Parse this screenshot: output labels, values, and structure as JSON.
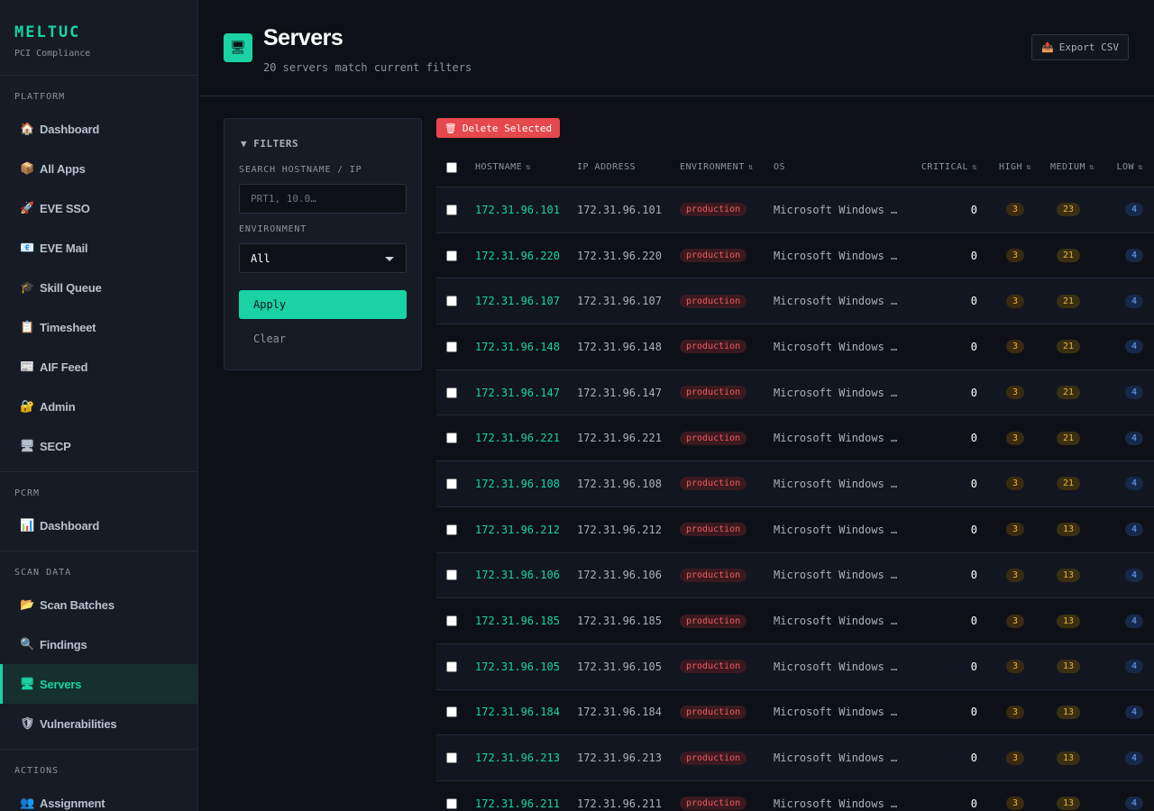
{
  "brand": {
    "name": "MELTUC",
    "subtitle": "PCI Compliance"
  },
  "sidebar": {
    "sections": [
      {
        "heading": "PLATFORM",
        "items": [
          {
            "icon": "🏠",
            "label": "Dashboard"
          },
          {
            "icon": "📦",
            "label": "All Apps"
          },
          {
            "icon": "🚀",
            "label": "EVE SSO"
          },
          {
            "icon": "📧",
            "label": "EVE Mail"
          },
          {
            "icon": "🎓",
            "label": "Skill Queue"
          },
          {
            "icon": "📋",
            "label": "Timesheet"
          },
          {
            "icon": "📰",
            "label": "AIF Feed"
          },
          {
            "icon": "🔐",
            "label": "Admin"
          },
          {
            "icon": "🖥",
            "label": "SECP"
          }
        ]
      },
      {
        "heading": "PCRM",
        "items": [
          {
            "icon": "📊",
            "label": "Dashboard"
          }
        ]
      },
      {
        "heading": "SCAN DATA",
        "items": [
          {
            "icon": "📂",
            "label": "Scan Batches"
          },
          {
            "icon": "🔍",
            "label": "Findings"
          },
          {
            "icon": "🖥",
            "label": "Servers",
            "active": true
          },
          {
            "icon": "🛡",
            "label": "Vulnerabilities"
          }
        ]
      },
      {
        "heading": "ACTIONS",
        "items": [
          {
            "icon": "👥",
            "label": "Assignment"
          }
        ]
      }
    ]
  },
  "header": {
    "icon": "🖥",
    "title": "Servers",
    "subtitle": "20 servers match current filters",
    "export_icon": "📤",
    "export_label": "Export CSV"
  },
  "filters": {
    "title": "▼ FILTERS",
    "search_label": "SEARCH HOSTNAME / IP",
    "search_placeholder": "PRT1, 10.0…",
    "search_value": "",
    "env_label": "ENVIRONMENT",
    "env_value": "All",
    "apply_label": "Apply",
    "clear_label": "Clear"
  },
  "actions": {
    "delete_icon": "🗑",
    "delete_label": "Delete Selected"
  },
  "table": {
    "columns": {
      "hostname": "HOSTNAME",
      "ip": "IP ADDRESS",
      "environment": "ENVIRONMENT",
      "os": "OS",
      "critical": "CRITICAL",
      "high": "HIGH",
      "medium": "MEDIUM",
      "low": "LOW"
    },
    "sort_glyph": "⇅",
    "rows": [
      {
        "hostname": "172.31.96.101",
        "ip": "172.31.96.101",
        "env": "production",
        "os": "Microsoft Windows …",
        "critical": "0",
        "high": "3",
        "medium": "23",
        "low": "4"
      },
      {
        "hostname": "172.31.96.220",
        "ip": "172.31.96.220",
        "env": "production",
        "os": "Microsoft Windows …",
        "critical": "0",
        "high": "3",
        "medium": "21",
        "low": "4"
      },
      {
        "hostname": "172.31.96.107",
        "ip": "172.31.96.107",
        "env": "production",
        "os": "Microsoft Windows …",
        "critical": "0",
        "high": "3",
        "medium": "21",
        "low": "4"
      },
      {
        "hostname": "172.31.96.148",
        "ip": "172.31.96.148",
        "env": "production",
        "os": "Microsoft Windows …",
        "critical": "0",
        "high": "3",
        "medium": "21",
        "low": "4"
      },
      {
        "hostname": "172.31.96.147",
        "ip": "172.31.96.147",
        "env": "production",
        "os": "Microsoft Windows …",
        "critical": "0",
        "high": "3",
        "medium": "21",
        "low": "4"
      },
      {
        "hostname": "172.31.96.221",
        "ip": "172.31.96.221",
        "env": "production",
        "os": "Microsoft Windows …",
        "critical": "0",
        "high": "3",
        "medium": "21",
        "low": "4"
      },
      {
        "hostname": "172.31.96.108",
        "ip": "172.31.96.108",
        "env": "production",
        "os": "Microsoft Windows …",
        "critical": "0",
        "high": "3",
        "medium": "21",
        "low": "4"
      },
      {
        "hostname": "172.31.96.212",
        "ip": "172.31.96.212",
        "env": "production",
        "os": "Microsoft Windows …",
        "critical": "0",
        "high": "3",
        "medium": "13",
        "low": "4"
      },
      {
        "hostname": "172.31.96.106",
        "ip": "172.31.96.106",
        "env": "production",
        "os": "Microsoft Windows …",
        "critical": "0",
        "high": "3",
        "medium": "13",
        "low": "4"
      },
      {
        "hostname": "172.31.96.185",
        "ip": "172.31.96.185",
        "env": "production",
        "os": "Microsoft Windows …",
        "critical": "0",
        "high": "3",
        "medium": "13",
        "low": "4"
      },
      {
        "hostname": "172.31.96.105",
        "ip": "172.31.96.105",
        "env": "production",
        "os": "Microsoft Windows …",
        "critical": "0",
        "high": "3",
        "medium": "13",
        "low": "4"
      },
      {
        "hostname": "172.31.96.184",
        "ip": "172.31.96.184",
        "env": "production",
        "os": "Microsoft Windows …",
        "critical": "0",
        "high": "3",
        "medium": "13",
        "low": "4"
      },
      {
        "hostname": "172.31.96.213",
        "ip": "172.31.96.213",
        "env": "production",
        "os": "Microsoft Windows …",
        "critical": "0",
        "high": "3",
        "medium": "13",
        "low": "4"
      },
      {
        "hostname": "172.31.96.211",
        "ip": "172.31.96.211",
        "env": "production",
        "os": "Microsoft Windows …",
        "critical": "0",
        "high": "3",
        "medium": "13",
        "low": "4"
      }
    ]
  },
  "colors": {
    "accent": "#19d3a5",
    "danger": "#e5484d",
    "background": "#0d1117",
    "panel": "#161b26"
  }
}
